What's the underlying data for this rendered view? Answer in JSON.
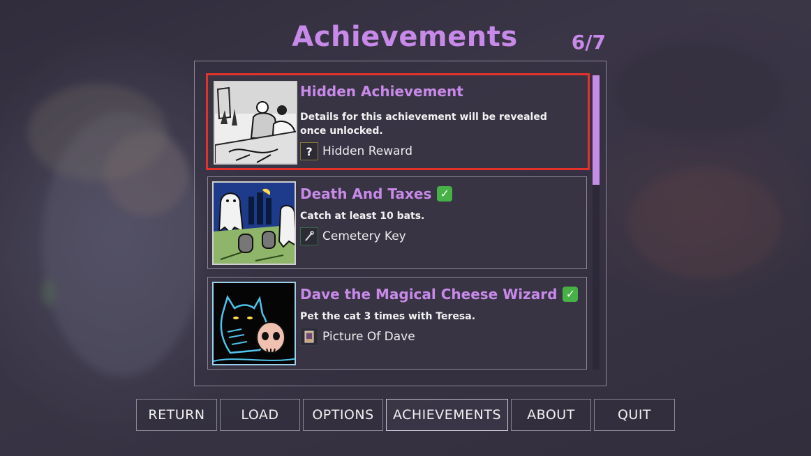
{
  "screen": {
    "title": "Achievements",
    "progress": "6/7"
  },
  "achievements": [
    {
      "title": "Hidden Achievement",
      "description": "Details for this achievement will be revealed once unlocked.",
      "reward": "Hidden Reward",
      "reward_icon": "question-mark-icon",
      "unlocked": false,
      "selected": true
    },
    {
      "title": "Death And Taxes",
      "description": "Catch at least 10 bats.",
      "reward": "Cemetery Key",
      "reward_icon": "key-icon",
      "unlocked": true,
      "selected": false
    },
    {
      "title": "Dave the Magical Cheese Wizard",
      "description": "Pet the cat 3 times with Teresa.",
      "reward": "Picture Of Dave",
      "reward_icon": "picture-icon",
      "unlocked": true,
      "selected": false
    }
  ],
  "menu": {
    "items": [
      "RETURN",
      "LOAD",
      "OPTIONS",
      "ACHIEVEMENTS",
      "ABOUT",
      "QUIT"
    ],
    "active": "ACHIEVEMENTS"
  },
  "colors": {
    "accent": "#c88ae8",
    "selection_border": "#e4322b",
    "check_green": "#47b047"
  },
  "scroll": {
    "position_fraction": 0.0,
    "visible_fraction": 0.37
  }
}
